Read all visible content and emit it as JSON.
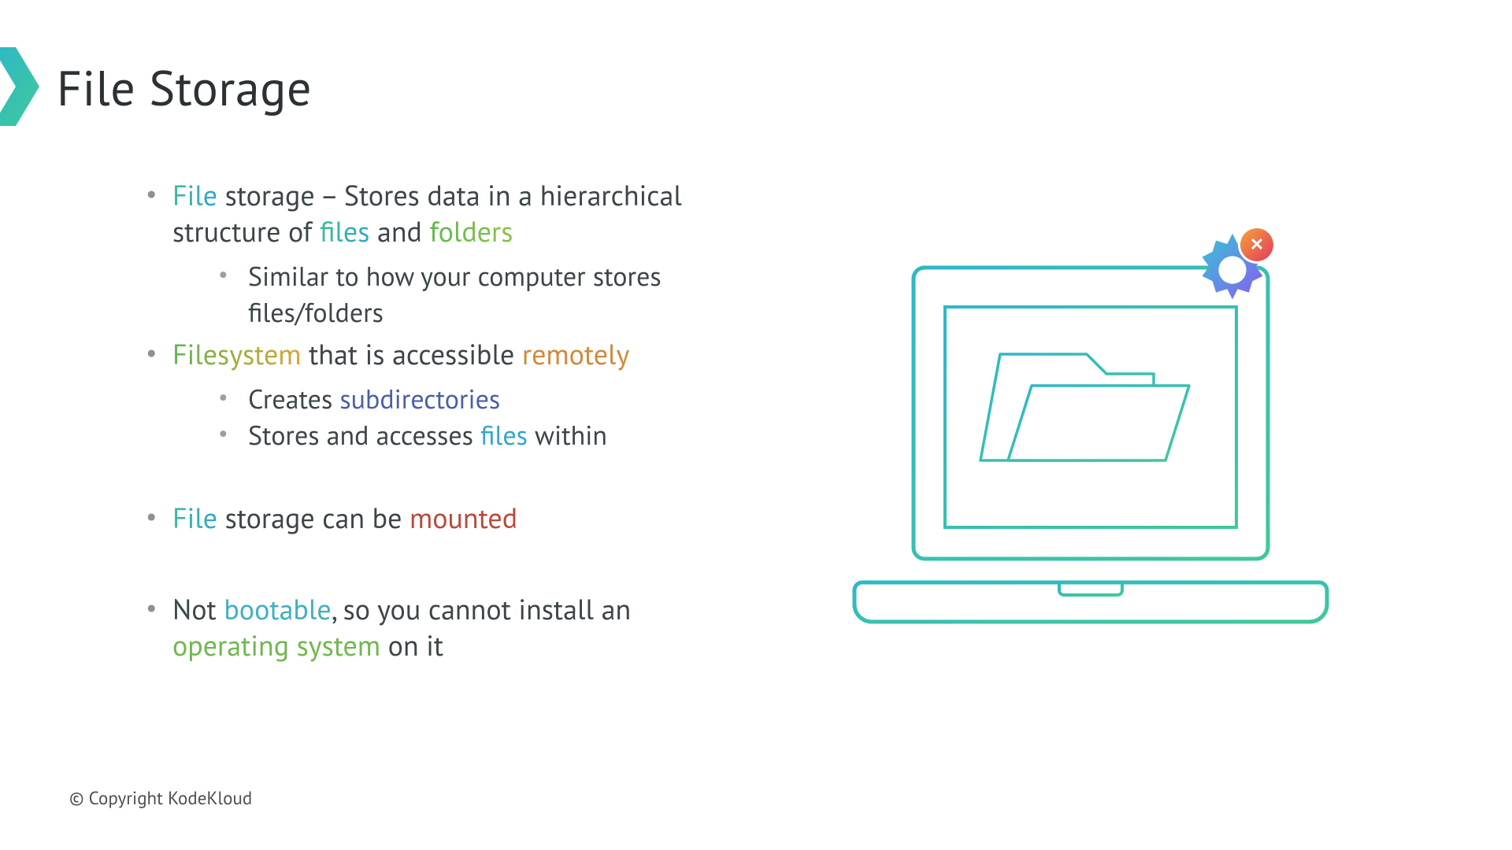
{
  "title": "File Storage",
  "copyright": "© Copyright KodeKloud",
  "bullets": {
    "b1": {
      "w_file": "File",
      "txt1": " storage – Stores data in a hierarchical structure of ",
      "w_files": "files",
      "txt2": " and ",
      "w_folders": "folders",
      "sub1": "Similar to how your computer stores files/folders"
    },
    "b2": {
      "w_filesystem": "Filesystem",
      "txt1": " that is accessible ",
      "w_remotely": "remotely",
      "sub1a": "Creates ",
      "sub1b": "subdirectories",
      "sub2a": "Stores and accesses ",
      "sub2b": "files",
      "sub2c": " within"
    },
    "b3": {
      "w_file": "File",
      "txt1": " storage can be ",
      "w_mounted": "mounted"
    },
    "b4": {
      "txt1": "Not ",
      "w_bootable": "bootable",
      "txt2": ", so you cannot install an ",
      "w_os": "operating system",
      "txt3": " on it"
    }
  },
  "icons": {
    "close_glyph": "✕"
  }
}
